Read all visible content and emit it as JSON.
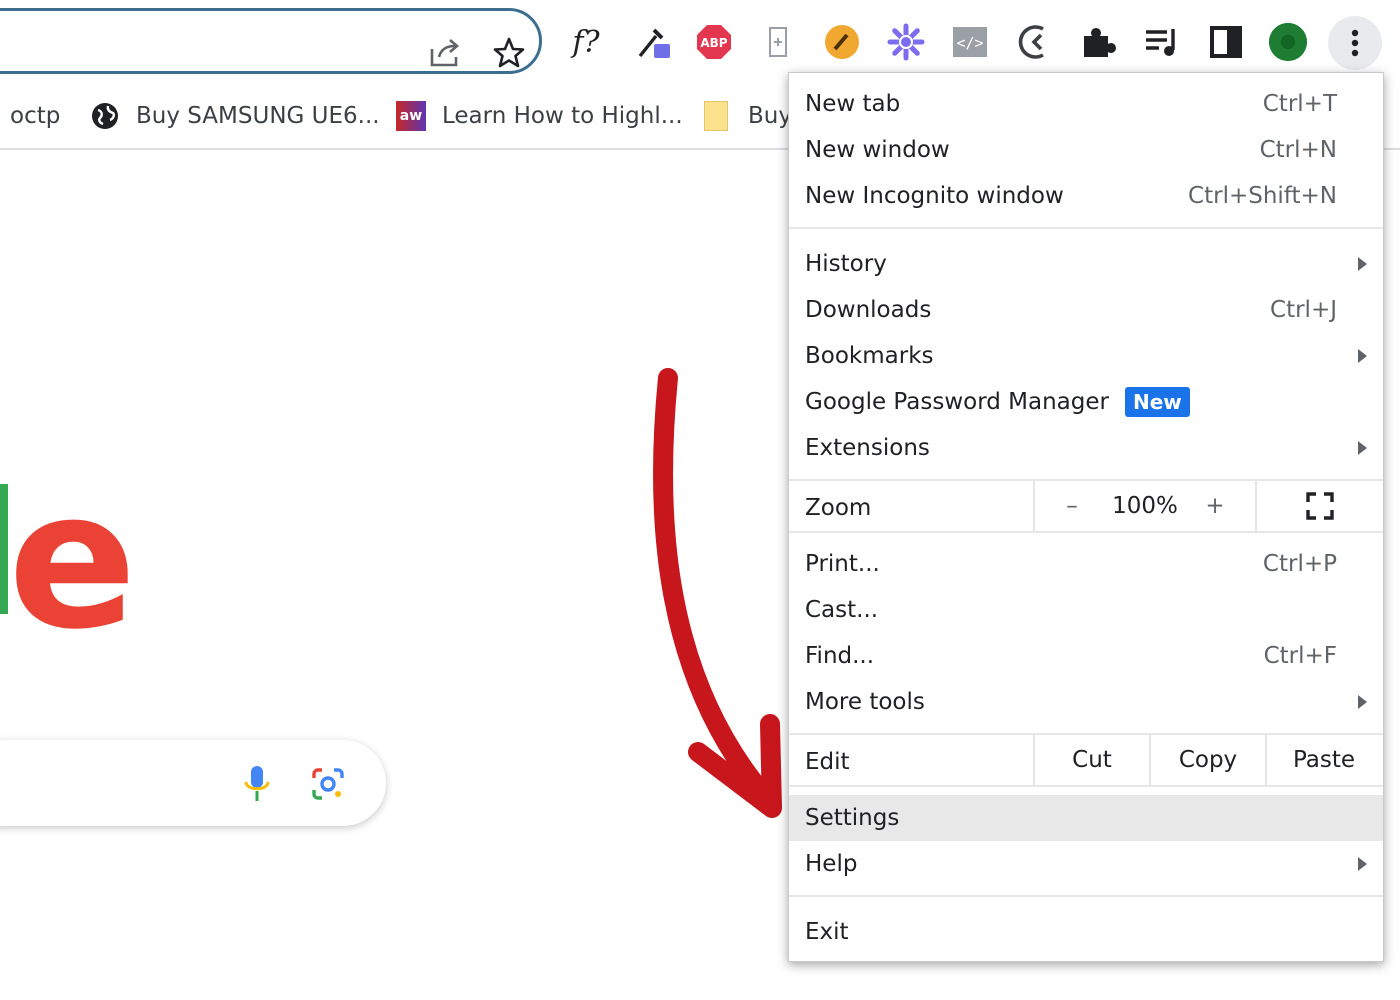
{
  "toolbar": {
    "extensions": [
      "fx-icon",
      "eyedropper-icon",
      "adblock-icon",
      "page-icon",
      "pencil-icon",
      "color-wheel-icon",
      "code-icon",
      "chevron-back-icon",
      "puzzle-icon",
      "playlist-icon",
      "sidepanel-icon",
      "avatar"
    ],
    "fx_label": "f?",
    "abp_label": "ABP",
    "code_label": "</>"
  },
  "bookmarks": [
    {
      "label": "octp",
      "icon": "none"
    },
    {
      "label": "Buy SAMSUNG UE6...",
      "icon": "globe-icon"
    },
    {
      "label": "Learn How to Highl...",
      "icon": "aw-icon",
      "icon_text": "aw"
    },
    {
      "label": "Buy",
      "icon": "folder-icon"
    }
  ],
  "page": {
    "logo_letter": "e"
  },
  "menu": {
    "new_tab": {
      "label": "New tab",
      "shortcut": "Ctrl+T"
    },
    "new_window": {
      "label": "New window",
      "shortcut": "Ctrl+N"
    },
    "incognito": {
      "label": "New Incognito window",
      "shortcut": "Ctrl+Shift+N"
    },
    "history": {
      "label": "History"
    },
    "downloads": {
      "label": "Downloads",
      "shortcut": "Ctrl+J"
    },
    "bookmarks": {
      "label": "Bookmarks"
    },
    "password_manager": {
      "label": "Google Password Manager",
      "badge": "New"
    },
    "extensions": {
      "label": "Extensions"
    },
    "zoom": {
      "label": "Zoom",
      "minus": "–",
      "value": "100%",
      "plus": "+"
    },
    "print": {
      "label": "Print...",
      "shortcut": "Ctrl+P"
    },
    "cast": {
      "label": "Cast..."
    },
    "find": {
      "label": "Find...",
      "shortcut": "Ctrl+F"
    },
    "more_tools": {
      "label": "More tools"
    },
    "edit": {
      "label": "Edit",
      "cut": "Cut",
      "copy": "Copy",
      "paste": "Paste"
    },
    "settings": {
      "label": "Settings"
    },
    "help": {
      "label": "Help"
    },
    "exit": {
      "label": "Exit"
    }
  },
  "colors": {
    "arrow": "#c8161d",
    "badge": "#1a73e8",
    "logo_e": "#ea4335",
    "logo_l": "#34a853"
  }
}
